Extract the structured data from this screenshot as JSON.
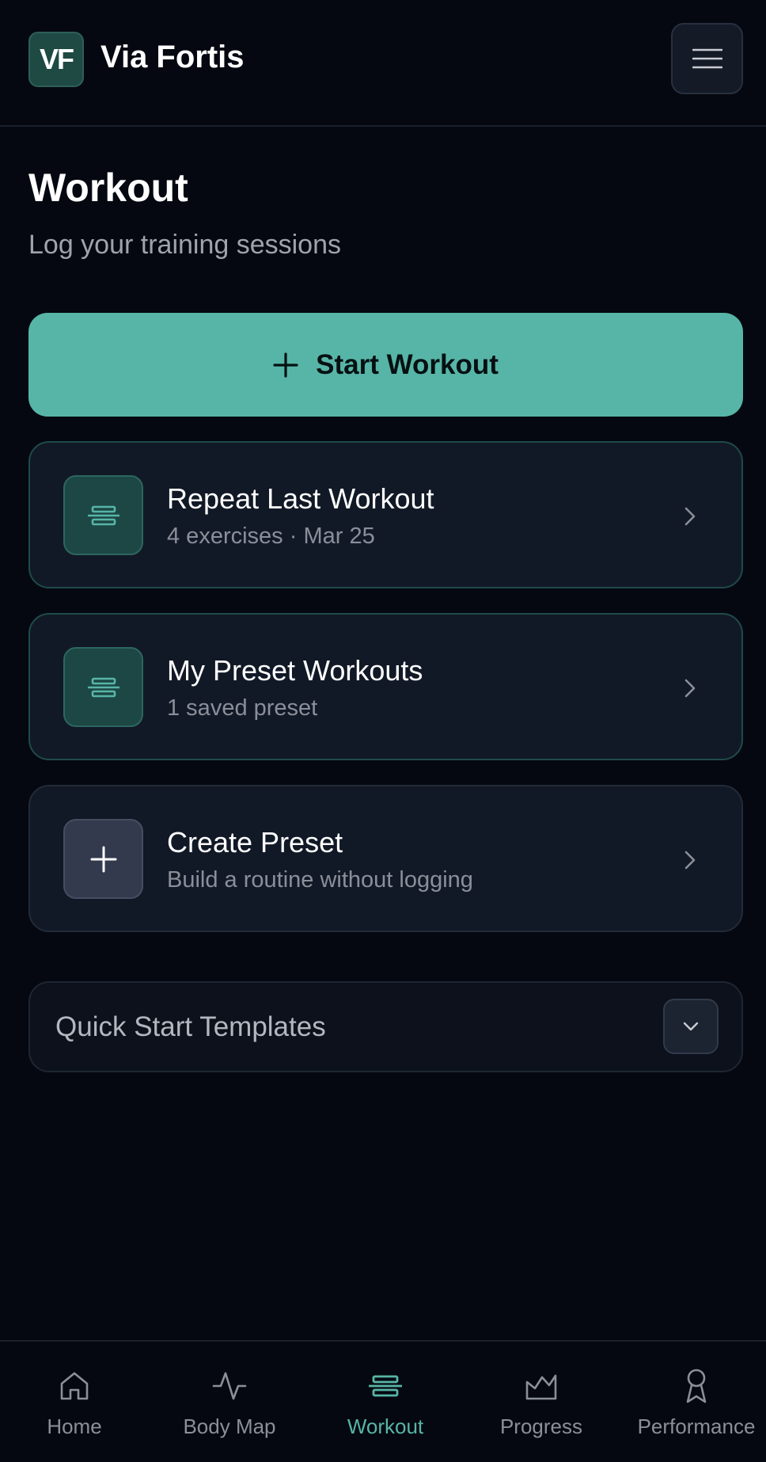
{
  "header": {
    "logo_text": "VF",
    "app_title": "Via Fortis",
    "menu_icon": "hamburger-icon"
  },
  "page": {
    "title": "Workout",
    "subtitle": "Log your training sessions"
  },
  "start_button": {
    "label": "Start Workout",
    "icon": "plus-icon"
  },
  "cards": [
    {
      "title": "Repeat Last Workout",
      "subtitle": "4 exercises · Mar 25",
      "icon": "dumbbell-icon",
      "style": "teal"
    },
    {
      "title": "My Preset Workouts",
      "subtitle": "1 saved preset",
      "icon": "dumbbell-icon",
      "style": "teal"
    },
    {
      "title": "Create Preset",
      "subtitle": "Build a routine without logging",
      "icon": "plus-icon",
      "style": "plain"
    }
  ],
  "quick_start": {
    "label": "Quick Start Templates",
    "icon": "chevron-down-icon"
  },
  "bottom_nav": {
    "active": "Workout",
    "items": [
      {
        "label": "Home",
        "icon": "home-icon"
      },
      {
        "label": "Body Map",
        "icon": "activity-icon"
      },
      {
        "label": "Workout",
        "icon": "dumbbell-icon"
      },
      {
        "label": "Progress",
        "icon": "chart-area-icon"
      },
      {
        "label": "Performance",
        "icon": "award-icon"
      }
    ]
  },
  "colors": {
    "background": "#050810",
    "accent": "#57b5a7",
    "card": "#121926",
    "muted_text": "#8a8f99"
  }
}
